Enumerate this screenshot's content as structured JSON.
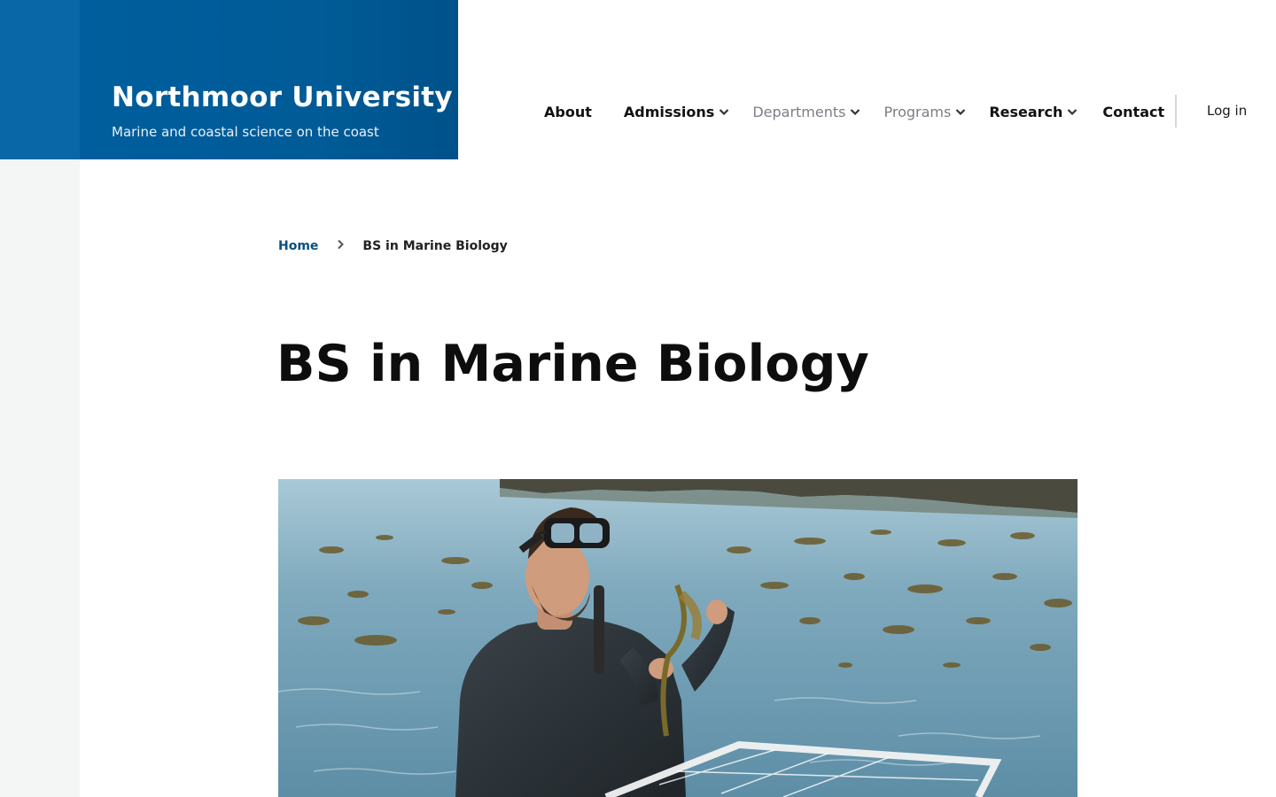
{
  "brand": {
    "name": "Northmoor University",
    "tagline": "Marine and coastal science on the coast",
    "color": "#005b96"
  },
  "nav": {
    "items": [
      {
        "label": "About",
        "has_dropdown": false,
        "muted": false
      },
      {
        "label": "Admissions",
        "has_dropdown": true,
        "muted": false
      },
      {
        "label": "Departments",
        "has_dropdown": true,
        "muted": true
      },
      {
        "label": "Programs",
        "has_dropdown": true,
        "muted": true
      },
      {
        "label": "Research",
        "has_dropdown": true,
        "muted": false
      },
      {
        "label": "Contact",
        "has_dropdown": false,
        "muted": false
      }
    ],
    "login_label": "Log in"
  },
  "breadcrumb": {
    "home_label": "Home",
    "separator_icon": "chevron-right-icon",
    "current_label": "BS in Marine Biology"
  },
  "page": {
    "title": "BS in Marine Biology"
  },
  "hero": {
    "icon": "photo",
    "description_visible": false
  },
  "colors": {
    "link": "#0b4f7f",
    "muted_nav": "#7a7f85",
    "rail": "#f4f6f6"
  }
}
